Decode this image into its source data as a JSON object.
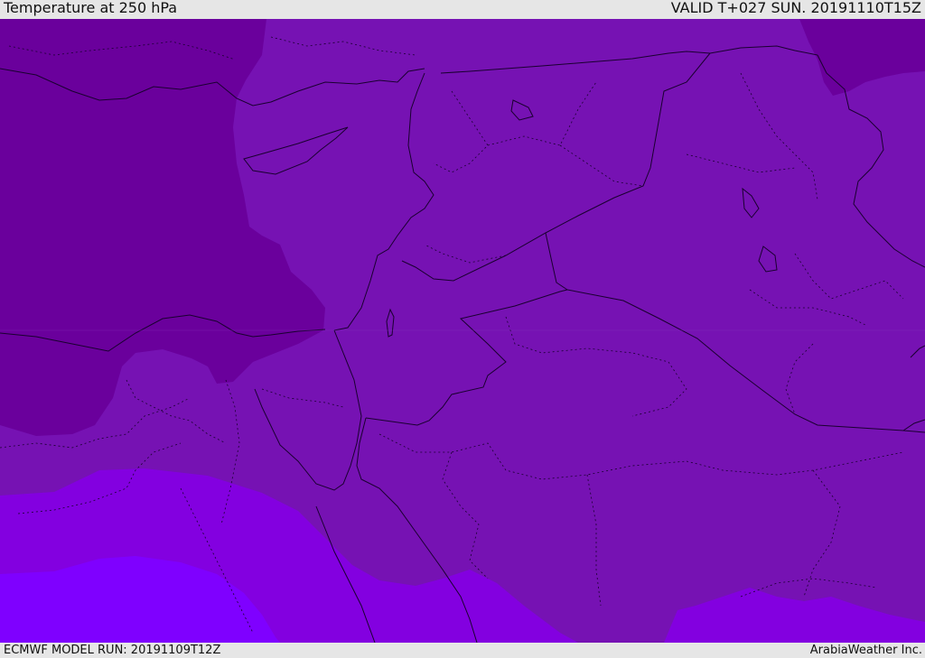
{
  "header": {
    "title": "Temperature at 250 hPa",
    "valid": "VALID T+027 SUN. 20191110T15Z"
  },
  "footer": {
    "model_run": "ECMWF MODEL RUN: 20191109T12Z",
    "credit": "ArabiaWeather Inc."
  },
  "map": {
    "field": "temperature",
    "level": "250 hPa",
    "colors": {
      "coldest": "#6a009c",
      "cold": "#7611b0",
      "mid": "#7a12bd",
      "warm": "#8500e0",
      "warmest": "#8000ff",
      "border": "#1a0030"
    }
  }
}
